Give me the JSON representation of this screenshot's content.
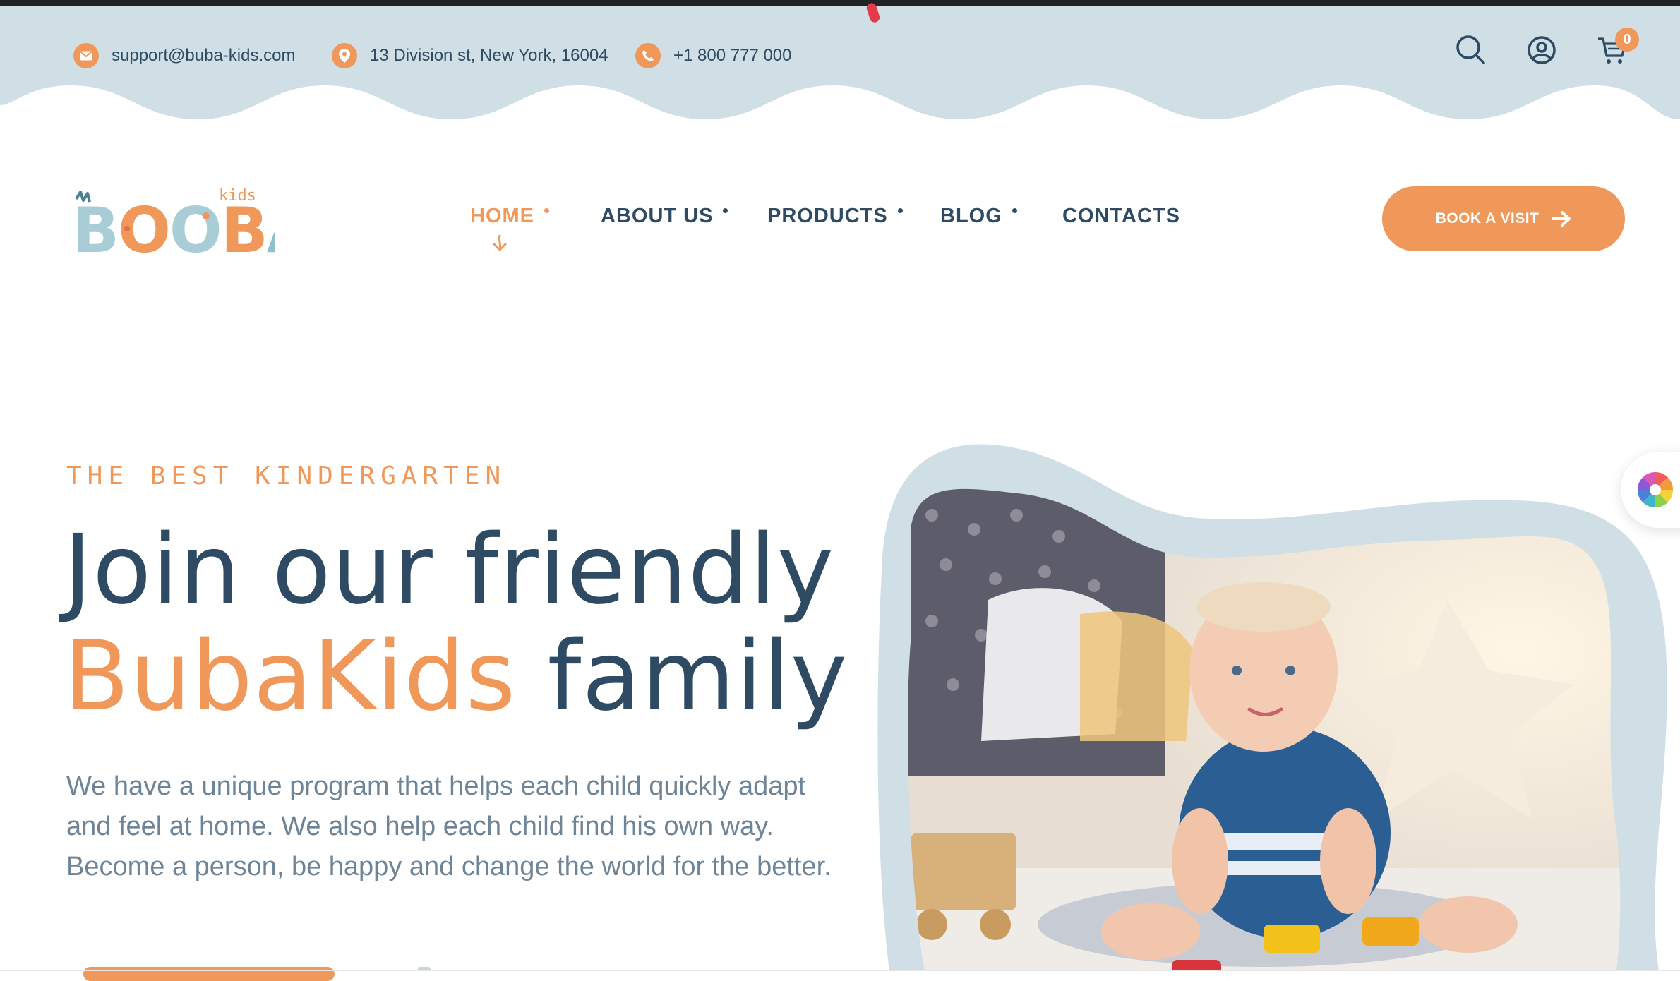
{
  "topbar": {
    "email": "support@buba-kids.com",
    "address": "13 Division st, New York, 16004",
    "phone": "+1 800 777 000",
    "cart_count": "0",
    "icons": [
      "mail-icon",
      "location-pin-icon",
      "phone-icon",
      "search-icon",
      "user-account-icon",
      "cart-icon"
    ],
    "bar_color": "#cfdfe5"
  },
  "header": {
    "logo_word": "BOOBA",
    "logo_sub": "kids",
    "nav": [
      {
        "label": "HOME",
        "active": true
      },
      {
        "label": "ABOUT US",
        "active": false
      },
      {
        "label": "PRODUCTS",
        "active": false
      },
      {
        "label": "BLOG",
        "active": false
      },
      {
        "label": "CONTACTS",
        "active": false
      }
    ],
    "cta_label": "BOOK A VISIT"
  },
  "hero": {
    "eyebrow": "THE BEST KINDERGARTEN",
    "title_line1": "Join our friendly",
    "title_accent": "BubaKids",
    "title_rest": " family",
    "description": "We have a unique program that helps each child quickly adapt and feel at home. We also help each child find his own way. Become a person, be happy and change the world for the better.",
    "image_subject": "toddler playing with toy cars on a rug"
  },
  "colors": {
    "accent": "#f0975a",
    "text_dark": "#2e4b63",
    "text_muted": "#6e8497",
    "soft_blue": "#cfdfe5"
  }
}
